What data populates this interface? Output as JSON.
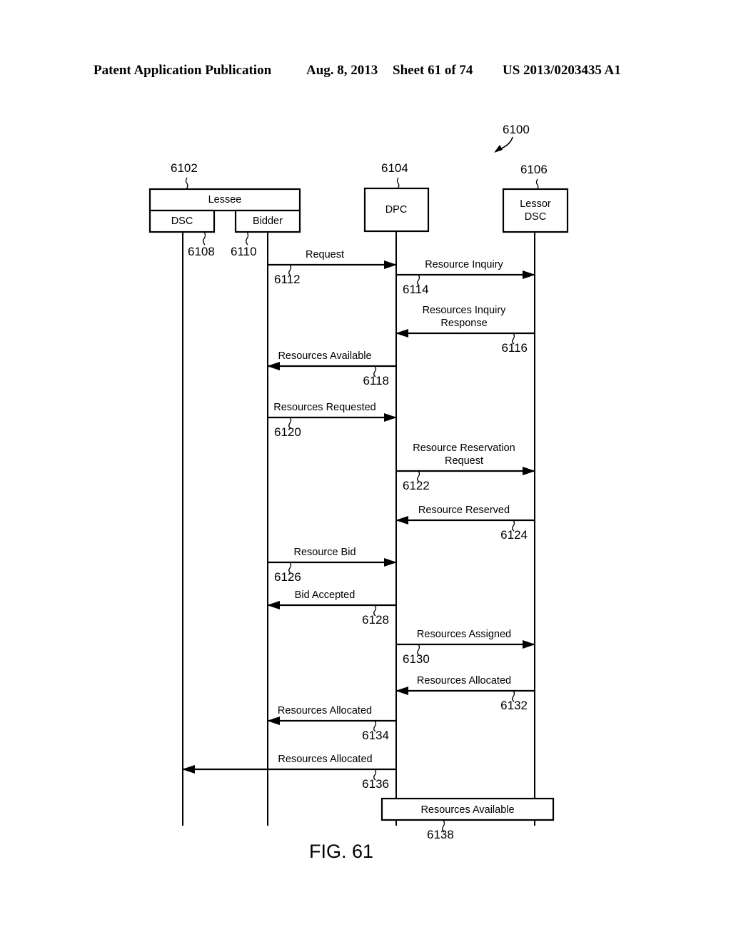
{
  "header": {
    "publication": "Patent Application Publication",
    "date": "Aug. 8, 2013",
    "sheet": "Sheet 61 of 74",
    "number": "US 2013/0203435 A1"
  },
  "figure": {
    "label": "FIG. 61",
    "ref": "6100"
  },
  "participants": [
    {
      "id": "dsc",
      "label": "DSC",
      "group": "Lessee",
      "group_ref": "6102",
      "ref": "6108"
    },
    {
      "id": "bidder",
      "label": "Bidder",
      "group": "Lessee",
      "group_ref": "6102",
      "ref": "6110"
    },
    {
      "id": "dpc",
      "label": "DPC",
      "ref": "6104"
    },
    {
      "id": "lessor",
      "label": "Lessor DSC",
      "lines": [
        "Lessor",
        "DSC"
      ],
      "ref": "6106"
    }
  ],
  "group": {
    "label": "Lessee",
    "ref": "6102"
  },
  "messages": [
    {
      "from": "bidder",
      "to": "dpc",
      "lines": [
        "Request"
      ],
      "ref": "6112"
    },
    {
      "from": "dpc",
      "to": "lessor",
      "lines": [
        "Resource Inquiry"
      ],
      "ref": "6114"
    },
    {
      "from": "lessor",
      "to": "dpc",
      "lines": [
        "Resources Inquiry",
        "Response"
      ],
      "ref": "6116"
    },
    {
      "from": "dpc",
      "to": "bidder",
      "lines": [
        "Resources Available"
      ],
      "ref": "6118"
    },
    {
      "from": "bidder",
      "to": "dpc",
      "lines": [
        "Resources Requested"
      ],
      "ref": "6120"
    },
    {
      "from": "dpc",
      "to": "lessor",
      "lines": [
        "Resource Reservation",
        "Request"
      ],
      "ref": "6122"
    },
    {
      "from": "lessor",
      "to": "dpc",
      "lines": [
        "Resource Reserved"
      ],
      "ref": "6124"
    },
    {
      "from": "bidder",
      "to": "dpc",
      "lines": [
        "Resource Bid"
      ],
      "ref": "6126"
    },
    {
      "from": "dpc",
      "to": "bidder",
      "lines": [
        "Bid Accepted"
      ],
      "ref": "6128"
    },
    {
      "from": "dpc",
      "to": "lessor",
      "lines": [
        "Resources Assigned"
      ],
      "ref": "6130"
    },
    {
      "from": "lessor",
      "to": "dpc",
      "lines": [
        "Resources Allocated"
      ],
      "ref": "6132"
    },
    {
      "from": "dpc",
      "to": "bidder",
      "lines": [
        "Resources Allocated"
      ],
      "ref": "6134"
    },
    {
      "from": "dpc",
      "to": "dsc",
      "lines": [
        "Resources Allocated"
      ],
      "ref": "6136"
    }
  ],
  "final_state": {
    "label": "Resources Available",
    "ref": "6138",
    "spans": [
      "dpc",
      "lessor"
    ]
  }
}
